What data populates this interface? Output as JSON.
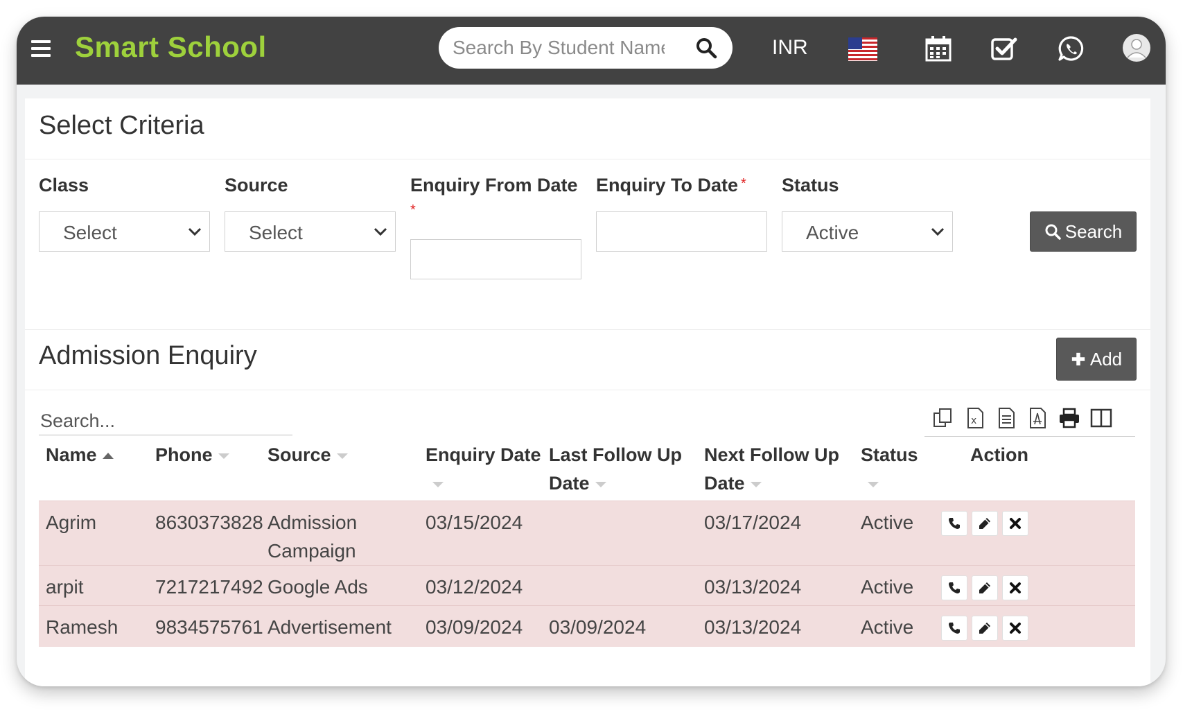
{
  "header": {
    "brand": "Smart School",
    "search_placeholder": "Search By Student Name",
    "currency": "INR"
  },
  "criteria": {
    "title": "Select Criteria",
    "class_label": "Class",
    "class_value": "Select",
    "source_label": "Source",
    "source_value": "Select",
    "from_label": "Enquiry From Date",
    "to_label": "Enquiry To Date",
    "required_mark": "*",
    "status_label": "Status",
    "status_value": "Active",
    "search_button": "Search"
  },
  "enquiry": {
    "title": "Admission Enquiry",
    "add_button": "Add",
    "search_placeholder": "Search...",
    "columns": {
      "name": "Name",
      "phone": "Phone",
      "source": "Source",
      "enquiry_date_1": "Enquiry Date",
      "last_follow_1": "Last Follow Up",
      "last_follow_2": "Date",
      "next_follow_1": "Next Follow Up",
      "next_follow_2": "Date",
      "status": "Status",
      "action": "Action"
    },
    "rows": [
      {
        "name": "Agrim",
        "phone": "8630373828",
        "source_1": "Admission",
        "source_2": "Campaign",
        "enquiry_date": "03/15/2024",
        "last_follow": "",
        "next_follow": "03/17/2024",
        "status": "Active"
      },
      {
        "name": "arpit",
        "phone": "7217217492",
        "source_1": "Google Ads",
        "source_2": "",
        "enquiry_date": "03/12/2024",
        "last_follow": "",
        "next_follow": "03/13/2024",
        "status": "Active"
      },
      {
        "name": "Ramesh",
        "phone": "9834575761",
        "source_1": "Advertisement",
        "source_2": "",
        "enquiry_date": "03/09/2024",
        "last_follow": "03/09/2024",
        "next_follow": "03/13/2024",
        "status": "Active"
      }
    ]
  },
  "colors": {
    "header_bg": "#424242",
    "brand": "#9ed13c",
    "row_bg": "#f2dede",
    "button_bg": "#595959"
  }
}
